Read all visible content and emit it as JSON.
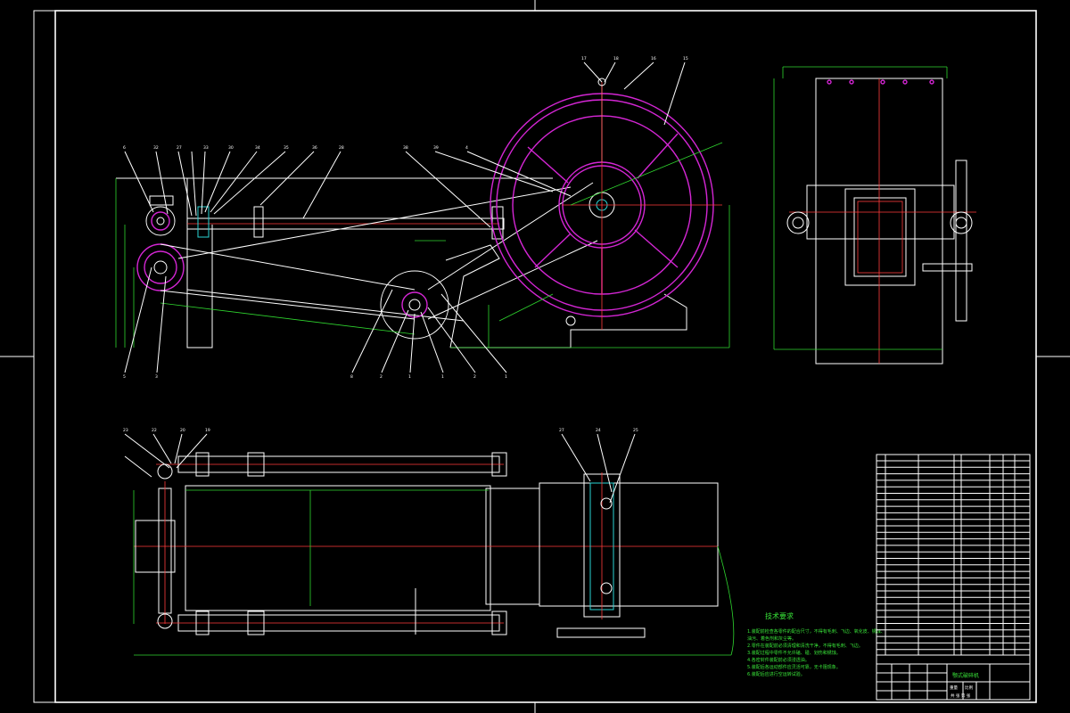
{
  "colors": {
    "background": "#000000",
    "outline": "#ffffff",
    "dimension": "#2fd62f",
    "centerline": "#ff3b3b",
    "flywheel": "#d426d4",
    "hidden": "#2ad4d4",
    "notes_text": "#39e539"
  },
  "balloons_front": [
    "6",
    "32",
    "27",
    "33",
    "30",
    "34",
    "35",
    "36",
    "28",
    "38",
    "39",
    "4",
    "5",
    "3",
    "8",
    "2",
    "1"
  ],
  "balloons_top": [
    "23",
    "22",
    "20",
    "19",
    "27",
    "24",
    "25"
  ],
  "balloons_wheel": [
    "17",
    "18",
    "16",
    "15"
  ],
  "tech_notes": {
    "title": "技术要求",
    "lines": [
      "1.装配前检查各零件的配合尺寸，不得有毛刺、飞边、氧化皮、锈蚀、",
      "油污、着色剂和灰尘等。",
      "2.零件在装配前必须清理和清洗干净，不得有毛刺、飞边。",
      "3.装配过程中零件不允许磕、碰、划伤和锈蚀。",
      "4.各密封件装配前必须浸透油。",
      "5.装配后各运动部件应灵活可靠，无卡阻现象。",
      "6.装配后应进行空运转试验。"
    ]
  },
  "title_block": {
    "drawing_name": "颚式破碎机",
    "scale_label": "比例",
    "weight_label": "重量",
    "sheet_label": "共 张 第 张"
  }
}
